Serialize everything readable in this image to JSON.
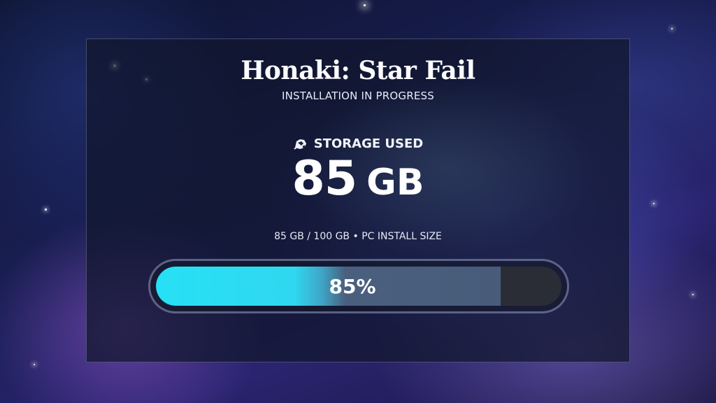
{
  "app": {
    "title": "Honaki: Star Fail",
    "subtitle": "INSTALLATION IN PROGRESS"
  },
  "storage": {
    "icon": "storage-icon",
    "label": "STORAGE USED",
    "value_number": "85",
    "value_unit": "GB",
    "detail": "85 GB / 100 GB • PC INSTALL SIZE"
  },
  "progress": {
    "percent_label": "85%",
    "fraction": 0.85,
    "fill_color": "#27e0f5",
    "track_color": "#2b2d36"
  }
}
